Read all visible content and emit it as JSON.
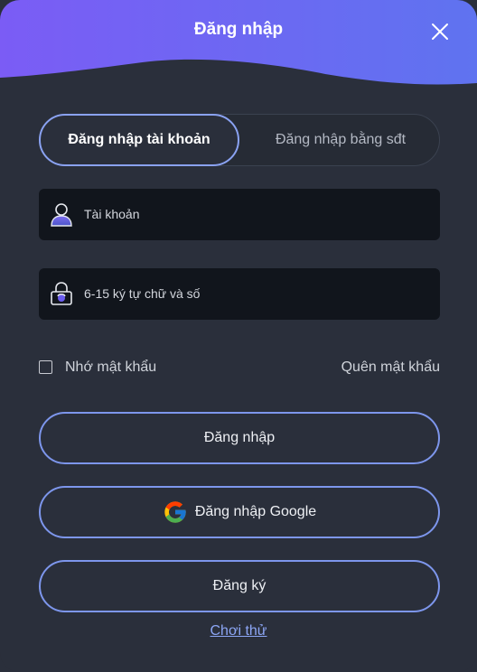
{
  "header": {
    "title": "Đăng nhập",
    "close_icon": "close-icon"
  },
  "tabs": [
    {
      "label": "Đăng nhập tài khoản",
      "active": true
    },
    {
      "label": "Đăng nhập bằng sđt",
      "active": false
    }
  ],
  "fields": {
    "account": {
      "placeholder": "Tài khoản",
      "icon": "user-icon"
    },
    "password": {
      "placeholder": "6-15 ký tự chữ và số",
      "icon": "lock-icon"
    }
  },
  "remember": {
    "label": "Nhớ mật khẩu",
    "checked": false
  },
  "forgot_label": "Quên mật khẩu",
  "buttons": {
    "login": "Đăng nhập",
    "google": "Đăng nhập Google",
    "register": "Đăng ký"
  },
  "trial_label": "Chơi thử",
  "colors": {
    "accent": "#7d96ec",
    "header_gradient_start": "#7b5cf5",
    "header_gradient_end": "#5f73f0",
    "background": "#2a2f3b",
    "field_background": "#11151c",
    "link": "#8ca6f5"
  }
}
